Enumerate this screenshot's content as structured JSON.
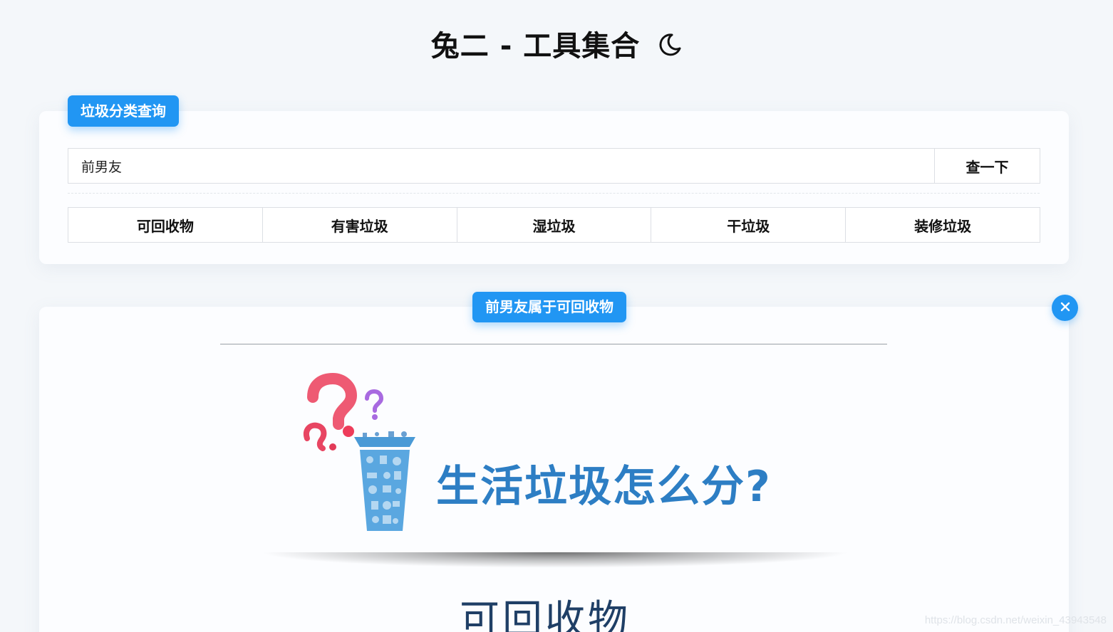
{
  "header": {
    "title": "兔二 - 工具集合",
    "theme_icon": "moon-icon"
  },
  "search_card": {
    "tag_label": "垃圾分类查询",
    "input_value": "前男友",
    "search_button_label": "查一下",
    "categories": [
      {
        "label": "可回收物"
      },
      {
        "label": "有害垃圾"
      },
      {
        "label": "湿垃圾"
      },
      {
        "label": "干垃圾"
      },
      {
        "label": "装修垃圾"
      }
    ]
  },
  "result_card": {
    "tag_label": "前男友属于可回收物",
    "close_icon": "close-icon",
    "image": {
      "headline": "生活垃圾怎么分?",
      "subheading": "可回收物"
    }
  },
  "watermark": "https://blog.csdn.net/weixin_43943548",
  "colors": {
    "accent": "#2196f3",
    "background": "#f4f7fa",
    "image_text": "#2d7ec4"
  }
}
